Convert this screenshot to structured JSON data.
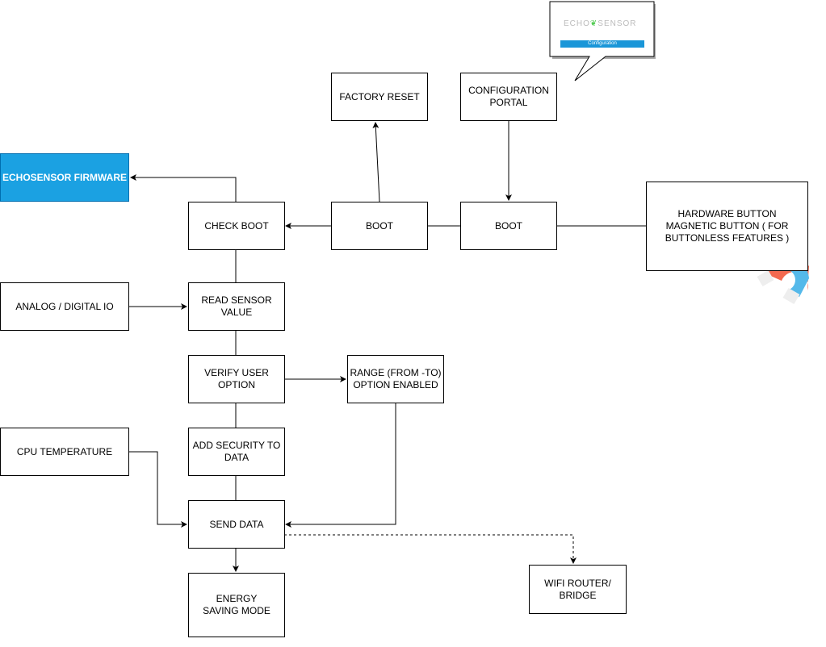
{
  "nodes": {
    "firmware": "ECHOSENSOR FIRMWARE",
    "check_boot": "CHECK BOOT",
    "boot1": "BOOT",
    "boot2": "BOOT",
    "factory_reset": "FACTORY RESET",
    "config_portal": "CONFIGURATION PORTAL",
    "hardware_button": "HARDWARE BUTTON MAGNETIC BUTTON ( FOR BUTTONLESS FEATURES )",
    "analog": "ANALOG / DIGITAL IO",
    "read_sensor": "READ SENSOR VALUE",
    "verify": "VERIFY USER OPTION",
    "range": "RANGE (FROM -TO) OPTION ENABLED",
    "cpu": "CPU TEMPERATURE",
    "security": "ADD SECURITY TO DATA",
    "send": "SEND DATA",
    "energy": "ENERGY SAVING MODE",
    "wifi": "WIFI ROUTER/ BRIDGE"
  },
  "callout": {
    "logo": "ECHOSENSOR",
    "button": "Configuration"
  },
  "colors": {
    "firmware_fill": "#1ba1e2",
    "magnet_red": "#f2694f",
    "magnet_blue": "#55b9ea"
  }
}
